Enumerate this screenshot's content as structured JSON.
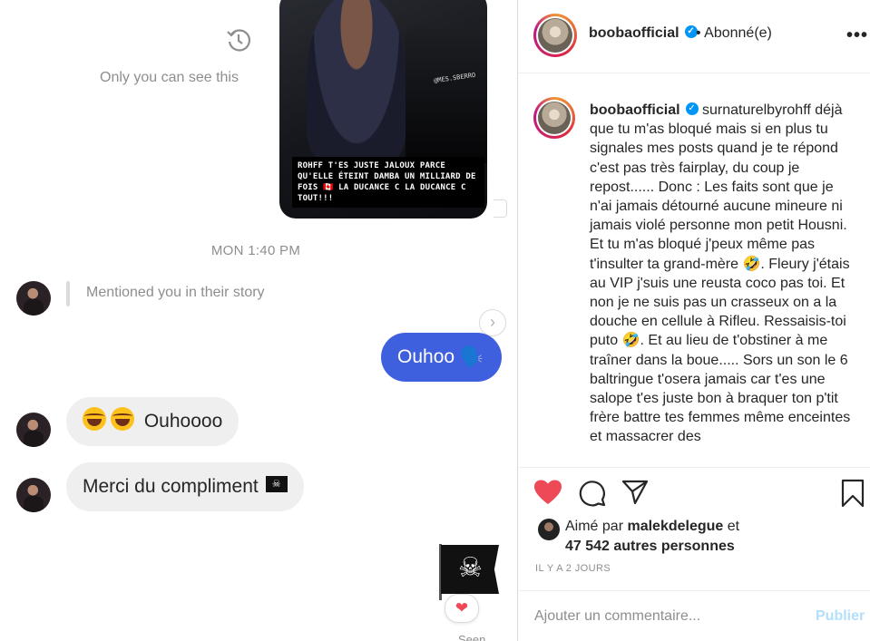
{
  "dm": {
    "story_caption": "ROHFF T'ES JUSTE JALOUX PARCE QU'ELLE ÉTEINT DAMBA UN MILLIARD DE FOIS 🇨🇦 LA DUCANCE C LA DUCANCE C TOUT!!!",
    "story_tag": "@MES.SBERRO",
    "only_you": "Only you can see this",
    "timestamp": "MON 1:40 PM",
    "mention": "Mentioned you in their story",
    "reply_glyph": "›",
    "out_message": "Ouhoo 🗣️",
    "in_message_1": "Ouhoooo",
    "in_message_2": "Merci du compliment",
    "pirate_flag": "☠",
    "big_flag_skull": "☠",
    "reaction": "❤",
    "seen": "Seen"
  },
  "post": {
    "username": "boobaofficial",
    "verified_mark": "✓",
    "follow_state": "• Abonné(e)",
    "more": "•••",
    "caption_mention": "surnaturelbyrohff",
    "caption": "déjà que tu m'as bloqué mais si en plus tu signales mes posts quand je te répond c'est pas très fairplay, du coup je repost...... Donc : Les faits sont que je n'ai jamais détourné aucune mineure ni jamais violé personne mon petit Housni. Et tu m'as bloqué j'peux même pas t'insulter ta grand-mère 🤣. Fleury j'étais au VIP j'suis une reusta coco pas toi. Et non je ne suis pas un crasseux on a la douche en cellule à Rifleu. Ressaisis-toi puto 🤣. Et au lieu de t'obstiner à me traîner dans la boue..... Sors un son le 6 baltringue t'osera jamais car t'es une salope t'es juste bon à braquer ton p'tit frère battre tes femmes même enceintes et massacrer des",
    "liked_prefix": "Aimé par",
    "liked_user": "malekdelegue",
    "liked_and": "et",
    "liked_others": "47 542 autres personnes",
    "time_ago": "IL Y A 2 JOURS",
    "comment_placeholder": "Ajouter un commentaire...",
    "publish": "Publier"
  },
  "colors": {
    "accent_blue": "#3f60de",
    "like_red": "#ed4956",
    "verified_blue": "#0095f6"
  }
}
